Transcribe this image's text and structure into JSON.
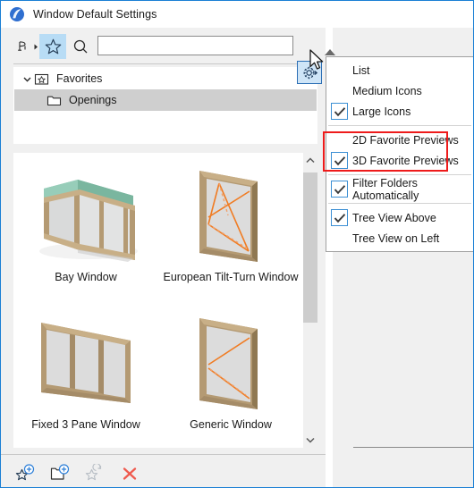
{
  "window": {
    "title": "Window Default Settings",
    "app_icon": "archicad-logo-icon",
    "border_color": "#1a7fd4"
  },
  "toolbar": {
    "chair_tool_icon": "chair-tool-icon",
    "favorites_icon": "star-favorites-icon",
    "search_icon": "magnifier-search-icon",
    "gear_icon": "gear-settings-icon",
    "search_value": "",
    "search_placeholder": "",
    "favorites_active": true,
    "gear_active": true,
    "highlight_color": "#b8dcf5"
  },
  "tree": {
    "items": [
      {
        "label": "Favorites",
        "icon": "favorites-folder-icon",
        "level": 0,
        "expanded": true,
        "selected": false
      },
      {
        "label": "Openings",
        "icon": "folder-icon",
        "level": 1,
        "expanded": false,
        "selected": true
      }
    ]
  },
  "thumbnails": {
    "items": [
      {
        "label": "Bay Window",
        "preview": "bay-window-3d"
      },
      {
        "label": "European Tilt-Turn Window",
        "preview": "tilt-turn-window-3d"
      },
      {
        "label": "Fixed 3 Pane Window",
        "preview": "fixed-3-pane-window-3d"
      },
      {
        "label": "Generic Window",
        "preview": "generic-window-3d"
      }
    ],
    "scrollbar": {
      "up_arrow": "chevron-up-icon",
      "down_arrow": "chevron-down-icon"
    }
  },
  "bottom_toolbar": {
    "buttons": [
      {
        "name": "new-favorite-button",
        "icon": "star-plus-icon",
        "enabled": true
      },
      {
        "name": "new-folder-button",
        "icon": "folder-plus-icon",
        "enabled": true
      },
      {
        "name": "redefine-favorite-button",
        "icon": "star-refresh-icon",
        "enabled": false
      },
      {
        "name": "delete-favorite-button",
        "icon": "red-x-icon",
        "enabled": true
      }
    ]
  },
  "menu": {
    "items": [
      {
        "label": "List",
        "checked": false,
        "separator_after": false
      },
      {
        "label": "Medium Icons",
        "checked": false,
        "separator_after": false
      },
      {
        "label": "Large Icons",
        "checked": true,
        "separator_after": true
      },
      {
        "label": "2D Favorite Previews",
        "checked": false,
        "separator_after": false
      },
      {
        "label": "3D Favorite Previews",
        "checked": true,
        "separator_after": true
      },
      {
        "label": "Filter Folders Automatically",
        "checked": true,
        "separator_after": true
      },
      {
        "label": "Tree View Above",
        "checked": true,
        "separator_after": false
      },
      {
        "label": "Tree View on Left",
        "checked": false,
        "separator_after": false
      }
    ],
    "highlight_box_color": "#ee1b1b",
    "check_box_border_color": "#3b8fd4"
  },
  "cursor": {
    "icon": "mouse-pointer-icon"
  }
}
